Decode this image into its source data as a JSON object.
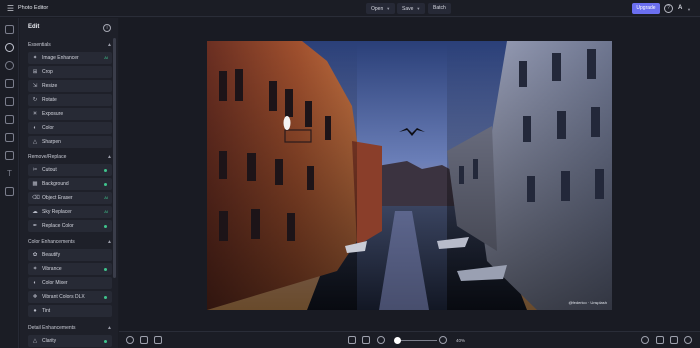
{
  "app": {
    "title": "Photo Editor"
  },
  "toolbar": {
    "open_label": "Open",
    "save_label": "Save",
    "batch_label": "Batch",
    "upgrade_label": "Upgrade",
    "user_initial": "A"
  },
  "panel": {
    "title": "Edit",
    "sections": [
      {
        "label": "Essentials",
        "items": [
          {
            "label": "Image Enhancer",
            "badge": "AI",
            "icon": "wand-icon"
          },
          {
            "label": "Crop",
            "badge": "",
            "icon": "crop-icon"
          },
          {
            "label": "Resize",
            "badge": "",
            "icon": "resize-icon"
          },
          {
            "label": "Rotate",
            "badge": "",
            "icon": "rotate-icon"
          },
          {
            "label": "Exposure",
            "badge": "",
            "icon": "exposure-icon"
          },
          {
            "label": "Color",
            "badge": "",
            "icon": "color-icon"
          },
          {
            "label": "Sharpen",
            "badge": "",
            "icon": "sharpen-icon"
          }
        ]
      },
      {
        "label": "Remove/Replace",
        "items": [
          {
            "label": "Cutout",
            "badge": "dot",
            "icon": "scissors-icon"
          },
          {
            "label": "Background",
            "badge": "dot",
            "icon": "background-icon"
          },
          {
            "label": "Object Eraser",
            "badge": "AI",
            "icon": "eraser-icon"
          },
          {
            "label": "Sky Replacer",
            "badge": "AI",
            "icon": "sky-icon"
          },
          {
            "label": "Replace Color",
            "badge": "dot",
            "icon": "brush-icon"
          }
        ]
      },
      {
        "label": "Color Enhancements",
        "items": [
          {
            "label": "Beautify",
            "badge": "",
            "icon": "beautify-icon"
          },
          {
            "label": "Vibrance",
            "badge": "dot",
            "icon": "vibrance-icon"
          },
          {
            "label": "Color Mixer",
            "badge": "",
            "icon": "mixer-icon"
          },
          {
            "label": "Vibrant Colors DLX",
            "badge": "dot",
            "icon": "palette-icon"
          },
          {
            "label": "Tint",
            "badge": "",
            "icon": "tint-icon"
          }
        ]
      },
      {
        "label": "Detail Enhancements",
        "items": [
          {
            "label": "Clarity",
            "badge": "dot",
            "icon": "clarity-icon"
          }
        ]
      }
    ]
  },
  "canvas": {
    "credit": "@federico · Unsplash"
  },
  "bottom": {
    "zoom_level": "40%"
  },
  "colors": {
    "accent": "#6b6ff0",
    "ai_badge": "#3fc48d",
    "panel_bg": "#1e2029",
    "item_bg": "#272a35"
  }
}
